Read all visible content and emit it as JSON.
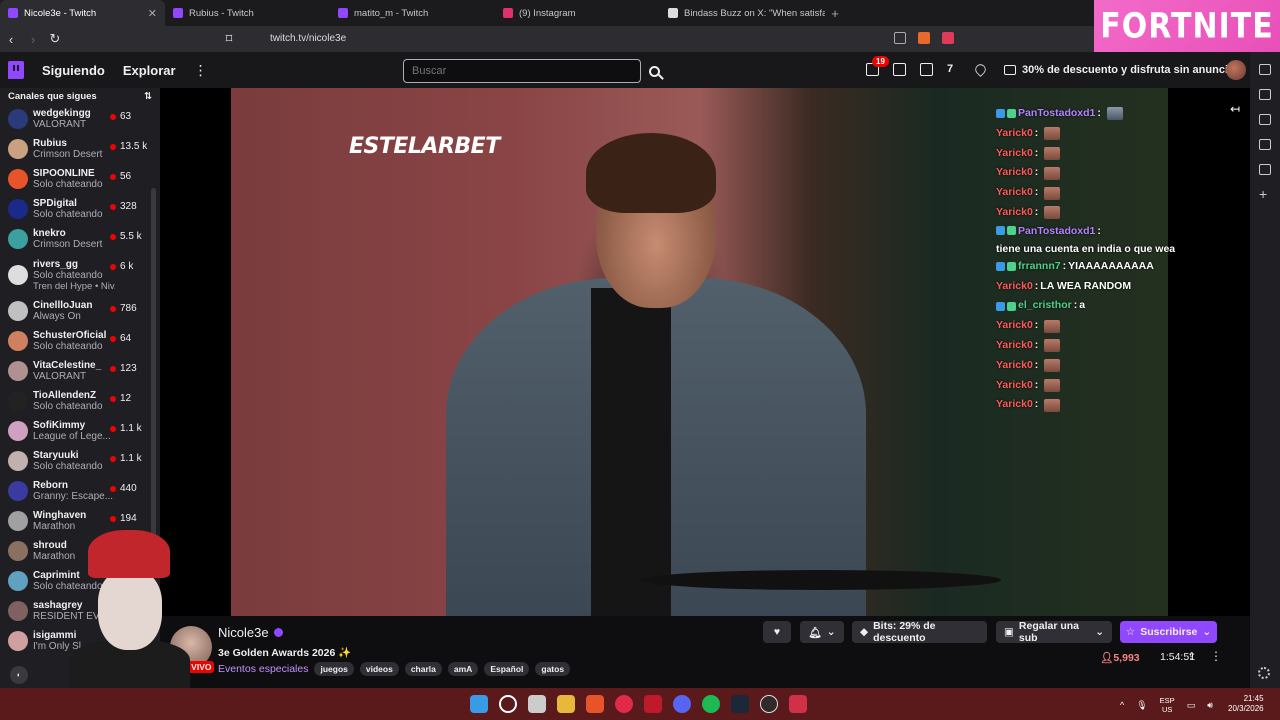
{
  "browser": {
    "tabs": [
      {
        "title": "Nicole3e - Twitch",
        "active": true,
        "icon": "twitch-icon"
      },
      {
        "title": "Rubius - Twitch",
        "active": false,
        "icon": "twitch-icon"
      },
      {
        "title": "matito_m - Twitch",
        "active": false,
        "icon": "twitch-icon"
      },
      {
        "title": "(9) Instagram",
        "active": false,
        "icon": "instagram-icon"
      },
      {
        "title": "Bindass Buzz on X: \"When satisfactio",
        "active": false,
        "icon": "x-icon"
      }
    ],
    "url": "twitch.tv/nicole3e",
    "ad_text": "FORTNITE"
  },
  "topnav": {
    "following": "Siguiendo",
    "explore": "Explorar",
    "search_placeholder": "Buscar",
    "notif_count": "19",
    "promo": "30% de descuento y disfruta sin anuncios"
  },
  "sidebar": {
    "header": "Canales que sigues",
    "channels": [
      {
        "name": "wedgekingg",
        "game": "VALORANT",
        "viewers": "63",
        "color": "#2a3a7a"
      },
      {
        "name": "Rubius",
        "game": "Crimson Desert",
        "viewers": "13.5 k",
        "color": "#c9a080"
      },
      {
        "name": "SIPOONLINE",
        "game": "Solo chateando",
        "viewers": "56",
        "color": "#e8542a"
      },
      {
        "name": "SPDigital",
        "game": "Solo chateando",
        "viewers": "328",
        "color": "#1a2a8a"
      },
      {
        "name": "knekro",
        "game": "Crimson Desert",
        "viewers": "5.5 k",
        "color": "#3aa0a0"
      },
      {
        "name": "rivers_gg",
        "game": "Solo chateando",
        "viewers": "6 k",
        "color": "#ddd",
        "hype": "Tren del Hype • Niv..."
      },
      {
        "name": "CinellloJuan",
        "game": "Always On",
        "viewers": "786",
        "color": "#c0c0c0"
      },
      {
        "name": "SchusterOficial",
        "game": "Solo chateando",
        "viewers": "64",
        "color": "#d08060"
      },
      {
        "name": "VitaCelestine_",
        "game": "VALORANT",
        "viewers": "123",
        "color": "#b09090"
      },
      {
        "name": "TioAllendenZ",
        "game": "Solo chateando",
        "viewers": "12",
        "color": "#222"
      },
      {
        "name": "SofiKimmy",
        "game": "League of Lege...",
        "viewers": "1.1 k",
        "color": "#d0a0c0"
      },
      {
        "name": "Staryuuki",
        "game": "Solo chateando",
        "viewers": "1.1 k",
        "color": "#c0b0b0"
      },
      {
        "name": "Reborn",
        "game": "Granny: Escape...",
        "viewers": "440",
        "color": "#3a3aa0"
      },
      {
        "name": "Winghaven",
        "game": "Marathon",
        "viewers": "194",
        "color": "#a0a0a0"
      },
      {
        "name": "shroud",
        "game": "Marathon",
        "viewers": "",
        "color": "#8a7060"
      },
      {
        "name": "Caprimint",
        "game": "Solo chateando",
        "viewers": "",
        "color": "#60a0c0"
      },
      {
        "name": "sashagrey",
        "game": "RESIDENT EV...",
        "viewers": "",
        "color": "#806060"
      },
      {
        "name": "isigammi",
        "game": "I'm Only Sl...",
        "viewers": "",
        "color": "#d0a0a0"
      }
    ]
  },
  "video": {
    "sponsor": "ESTELARBET"
  },
  "chat": [
    {
      "user": "PanTostadoxd1",
      "color": "#b383ff",
      "msg": "",
      "emote": "grey"
    },
    {
      "user": "Yarick0",
      "color": "#ff5a5a",
      "msg": "",
      "emote": "red"
    },
    {
      "user": "Yarick0",
      "color": "#ff5a5a",
      "msg": "",
      "emote": "red"
    },
    {
      "user": "Yarick0",
      "color": "#ff5a5a",
      "msg": "",
      "emote": "red"
    },
    {
      "user": "Yarick0",
      "color": "#ff5a5a",
      "msg": "",
      "emote": "red"
    },
    {
      "user": "Yarick0",
      "color": "#ff5a5a",
      "msg": "",
      "emote": "red"
    },
    {
      "user": "PanTostadoxd1",
      "color": "#b383ff",
      "msg": "tiene una cuenta en india o que wea",
      "emote": ""
    },
    {
      "user": "frrannn7",
      "color": "#4fd18b",
      "msg": "YIAAAAAAAAAA",
      "emote": ""
    },
    {
      "user": "Yarick0",
      "color": "#ff5a5a",
      "msg": "LA WEA RANDOM",
      "emote": ""
    },
    {
      "user": "el_cristhor",
      "color": "#4fd18b",
      "msg": "a",
      "emote": ""
    },
    {
      "user": "Yarick0",
      "color": "#ff5a5a",
      "msg": "",
      "emote": "red"
    },
    {
      "user": "Yarick0",
      "color": "#ff5a5a",
      "msg": "",
      "emote": "red"
    },
    {
      "user": "Yarick0",
      "color": "#ff5a5a",
      "msg": "",
      "emote": "red"
    },
    {
      "user": "Yarick0",
      "color": "#ff5a5a",
      "msg": "",
      "emote": "red"
    },
    {
      "user": "Yarick0",
      "color": "#ff5a5a",
      "msg": "",
      "emote": "red"
    }
  ],
  "stream": {
    "channel": "Nicole3e",
    "live": "EN VIVO",
    "title": "3e Golden Awards 2026 ✨",
    "category": "Eventos especiales",
    "tags": [
      "juegos",
      "videos",
      "charla",
      "amA",
      "Español",
      "gatos"
    ],
    "bits": "Bits: 29% de descuento",
    "gift": "Regalar una sub",
    "subscribe": "Suscribirse",
    "viewers": "5,993",
    "uptime": "1:54:51"
  },
  "taskbar": {
    "lang1": "ESP",
    "lang2": "US",
    "time": "21:45",
    "date": "20/3/2026"
  }
}
